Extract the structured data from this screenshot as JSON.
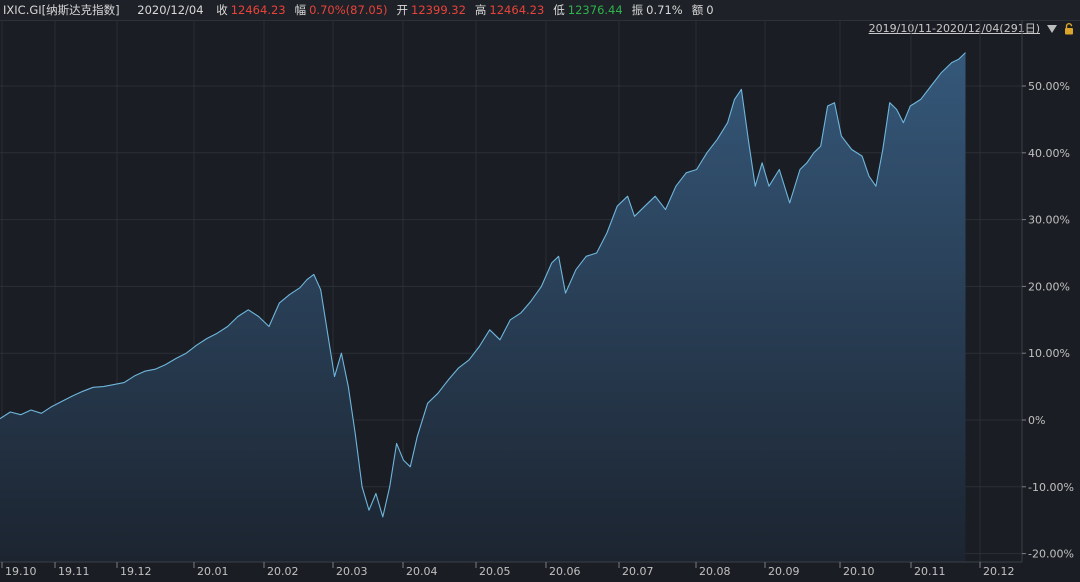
{
  "header": {
    "symbol": "IXIC.GI[纳斯达克指数]",
    "date": "2020/12/04",
    "fields": [
      {
        "label": "收",
        "value": "12464.23",
        "color": "up"
      },
      {
        "label": "幅",
        "value": "0.70%(87.05)",
        "color": "up"
      },
      {
        "label": "开",
        "value": "12399.32",
        "color": "up"
      },
      {
        "label": "高",
        "value": "12464.23",
        "color": "up"
      },
      {
        "label": "低",
        "value": "12376.44",
        "color": "down"
      },
      {
        "label": "振",
        "value": "0.71%",
        "color": "neutral"
      },
      {
        "label": "额",
        "value": "0",
        "color": "neutral"
      }
    ]
  },
  "range_selector": {
    "label": "2019/10/11-2020/12/04(291日)",
    "dropdown_icon": "triangle-down-icon",
    "lock_icon": "lock-icon"
  },
  "colors": {
    "background": "#1a1d23",
    "line": "#6fb6dc",
    "fill_top": "#35587a",
    "fill_bottom": "#1c2430",
    "grid": "#2b2f36",
    "up": "#e8433a",
    "down": "#2fb24a"
  },
  "chart_data": {
    "type": "area",
    "x_tick_labels": [
      "19.10",
      "19.11",
      "19.12",
      "20.01",
      "20.02",
      "20.03",
      "20.04",
      "20.05",
      "20.06",
      "20.07",
      "20.08",
      "20.09",
      "20.10",
      "20.11",
      "20.12"
    ],
    "y_tick_labels": [
      "50.00%",
      "40.00%",
      "30.00%",
      "20.00%",
      "10.00%",
      "0%",
      "-10.00%",
      "-20.00%"
    ],
    "y_tick_values": [
      50,
      40,
      30,
      20,
      10,
      0,
      -10,
      -20
    ],
    "ylim": [
      -20,
      55
    ],
    "y_unit": "%",
    "x_unit": "trading day index",
    "xlim": [
      0,
      290
    ],
    "points": [
      [
        0,
        0.2
      ],
      [
        3,
        1.2
      ],
      [
        6,
        0.8
      ],
      [
        9,
        1.5
      ],
      [
        12,
        1.0
      ],
      [
        15,
        2.0
      ],
      [
        18,
        2.8
      ],
      [
        21,
        3.6
      ],
      [
        24,
        4.3
      ],
      [
        27,
        4.9
      ],
      [
        30,
        5.0
      ],
      [
        33,
        5.3
      ],
      [
        36,
        5.6
      ],
      [
        39,
        6.6
      ],
      [
        42,
        7.3
      ],
      [
        45,
        7.6
      ],
      [
        48,
        8.3
      ],
      [
        51,
        9.2
      ],
      [
        54,
        10.0
      ],
      [
        57,
        11.2
      ],
      [
        60,
        12.2
      ],
      [
        63,
        13.0
      ],
      [
        66,
        14.0
      ],
      [
        69,
        15.5
      ],
      [
        72,
        16.5
      ],
      [
        75,
        15.5
      ],
      [
        78,
        14.0
      ],
      [
        81,
        17.5
      ],
      [
        84,
        18.8
      ],
      [
        87,
        19.8
      ],
      [
        89,
        21.0
      ],
      [
        91,
        21.8
      ],
      [
        93,
        19.5
      ],
      [
        95,
        13.0
      ],
      [
        97,
        6.5
      ],
      [
        99,
        10.0
      ],
      [
        101,
        5.0
      ],
      [
        103,
        -2.0
      ],
      [
        105,
        -10.0
      ],
      [
        107,
        -13.5
      ],
      [
        109,
        -11.0
      ],
      [
        111,
        -14.5
      ],
      [
        113,
        -10.0
      ],
      [
        115,
        -3.5
      ],
      [
        117,
        -6.0
      ],
      [
        119,
        -7.0
      ],
      [
        121,
        -2.5
      ],
      [
        124,
        2.5
      ],
      [
        127,
        4.0
      ],
      [
        130,
        6.0
      ],
      [
        133,
        7.8
      ],
      [
        136,
        9.0
      ],
      [
        139,
        11.0
      ],
      [
        142,
        13.5
      ],
      [
        145,
        12.0
      ],
      [
        148,
        15.0
      ],
      [
        151,
        16.0
      ],
      [
        154,
        17.8
      ],
      [
        157,
        20.0
      ],
      [
        160,
        23.5
      ],
      [
        162,
        24.5
      ],
      [
        164,
        19.0
      ],
      [
        167,
        22.5
      ],
      [
        170,
        24.5
      ],
      [
        173,
        25.0
      ],
      [
        176,
        28.0
      ],
      [
        179,
        32.0
      ],
      [
        182,
        33.5
      ],
      [
        184,
        30.5
      ],
      [
        187,
        32.0
      ],
      [
        190,
        33.5
      ],
      [
        193,
        31.5
      ],
      [
        196,
        35.0
      ],
      [
        199,
        37.0
      ],
      [
        202,
        37.5
      ],
      [
        205,
        40.0
      ],
      [
        208,
        42.0
      ],
      [
        211,
        44.5
      ],
      [
        213,
        48.0
      ],
      [
        215,
        49.5
      ],
      [
        217,
        42.0
      ],
      [
        219,
        35.0
      ],
      [
        221,
        38.5
      ],
      [
        223,
        35.0
      ],
      [
        226,
        37.5
      ],
      [
        229,
        32.5
      ],
      [
        232,
        37.5
      ],
      [
        234,
        38.5
      ],
      [
        236,
        40.0
      ],
      [
        238,
        41.0
      ],
      [
        240,
        47.0
      ],
      [
        242,
        47.5
      ],
      [
        244,
        42.5
      ],
      [
        247,
        40.5
      ],
      [
        250,
        39.5
      ],
      [
        252,
        36.5
      ],
      [
        254,
        35.0
      ],
      [
        256,
        40.5
      ],
      [
        258,
        47.5
      ],
      [
        260,
        46.5
      ],
      [
        262,
        44.5
      ],
      [
        264,
        47.0
      ],
      [
        267,
        48.0
      ],
      [
        270,
        50.0
      ],
      [
        273,
        52.0
      ],
      [
        276,
        53.5
      ],
      [
        278,
        54.0
      ],
      [
        280,
        55.0
      ]
    ]
  }
}
